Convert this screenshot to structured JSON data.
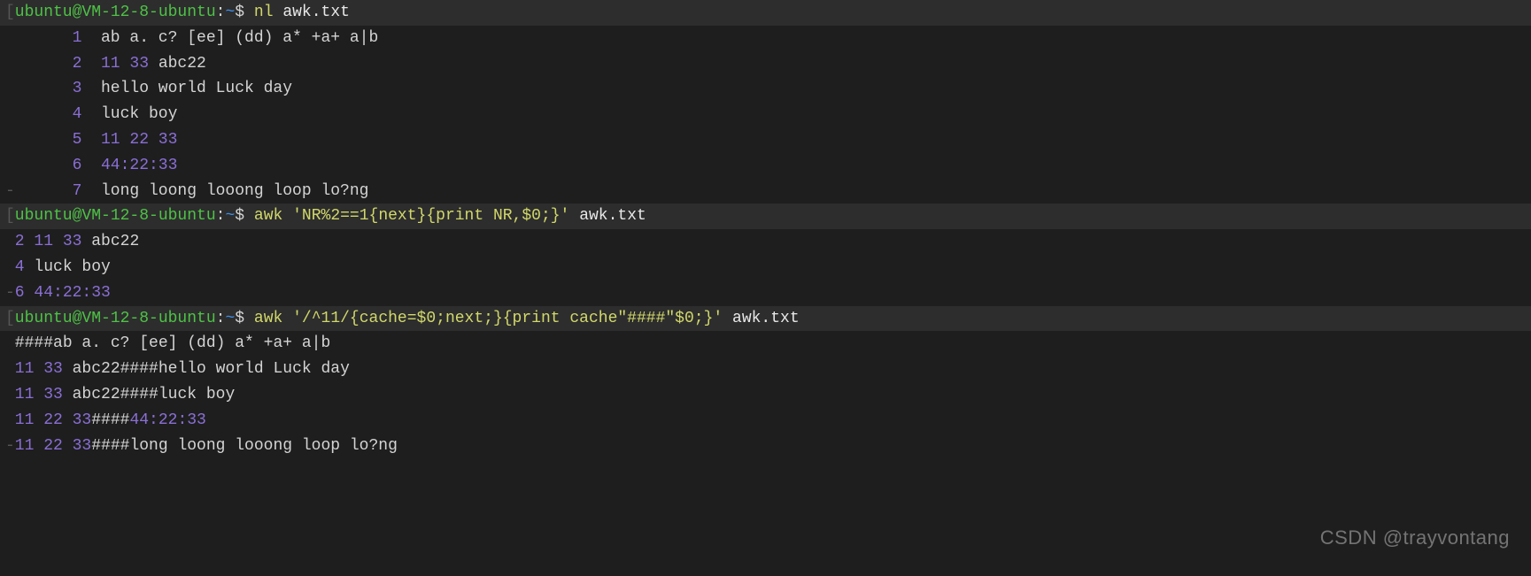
{
  "prompt": {
    "user_host": "ubuntu@VM-12-8-ubuntu",
    "colon": ":",
    "path": "~",
    "dollar": "$"
  },
  "cmd1": {
    "cmd": "nl",
    "arg": "awk.txt"
  },
  "nl_output": [
    {
      "n": "1",
      "text": "ab a. c? [ee] (dd) a* +a+ a|b"
    },
    {
      "n": "2",
      "nums": "11 33",
      "text": " abc22"
    },
    {
      "n": "3",
      "text": "hello world Luck day"
    },
    {
      "n": "4",
      "text": "luck boy"
    },
    {
      "n": "5",
      "nums": "11 22 33",
      "text": ""
    },
    {
      "n": "6",
      "nums": "44:22:33",
      "text": ""
    },
    {
      "n": "7",
      "text": "long loong looong loop lo?ng"
    }
  ],
  "cmd2": {
    "cmd": "awk",
    "script": "'NR%2==1{next}{print NR,$0;}'",
    "arg": "awk.txt"
  },
  "out2": [
    {
      "n": "2",
      "nums": "11 33",
      "text": " abc22"
    },
    {
      "n": "4",
      "text": " luck boy"
    },
    {
      "n": "6",
      "nums": "44:22:33",
      "text": ""
    }
  ],
  "cmd3": {
    "cmd": "awk",
    "script": "'/^11/{cache=$0;next;}{print cache\"####\"$0;}'",
    "arg": "awk.txt"
  },
  "out3": [
    {
      "pre": "####",
      "text": "ab a. c? [ee] (dd) a* +a+ a|b"
    },
    {
      "nums": "11 33",
      "mid": " abc22####",
      "text": "hello world Luck day"
    },
    {
      "nums": "11 33",
      "mid": " abc22####",
      "text": "luck boy"
    },
    {
      "nums": "11 22 33",
      "mid": "####",
      "nums2": "44:22:33"
    },
    {
      "nums": "11 22 33",
      "mid": "####",
      "text": "long loong looong loop lo?ng"
    }
  ],
  "watermark": "CSDN @trayvontang",
  "gutter_open": "[",
  "gutter_dash": "-"
}
